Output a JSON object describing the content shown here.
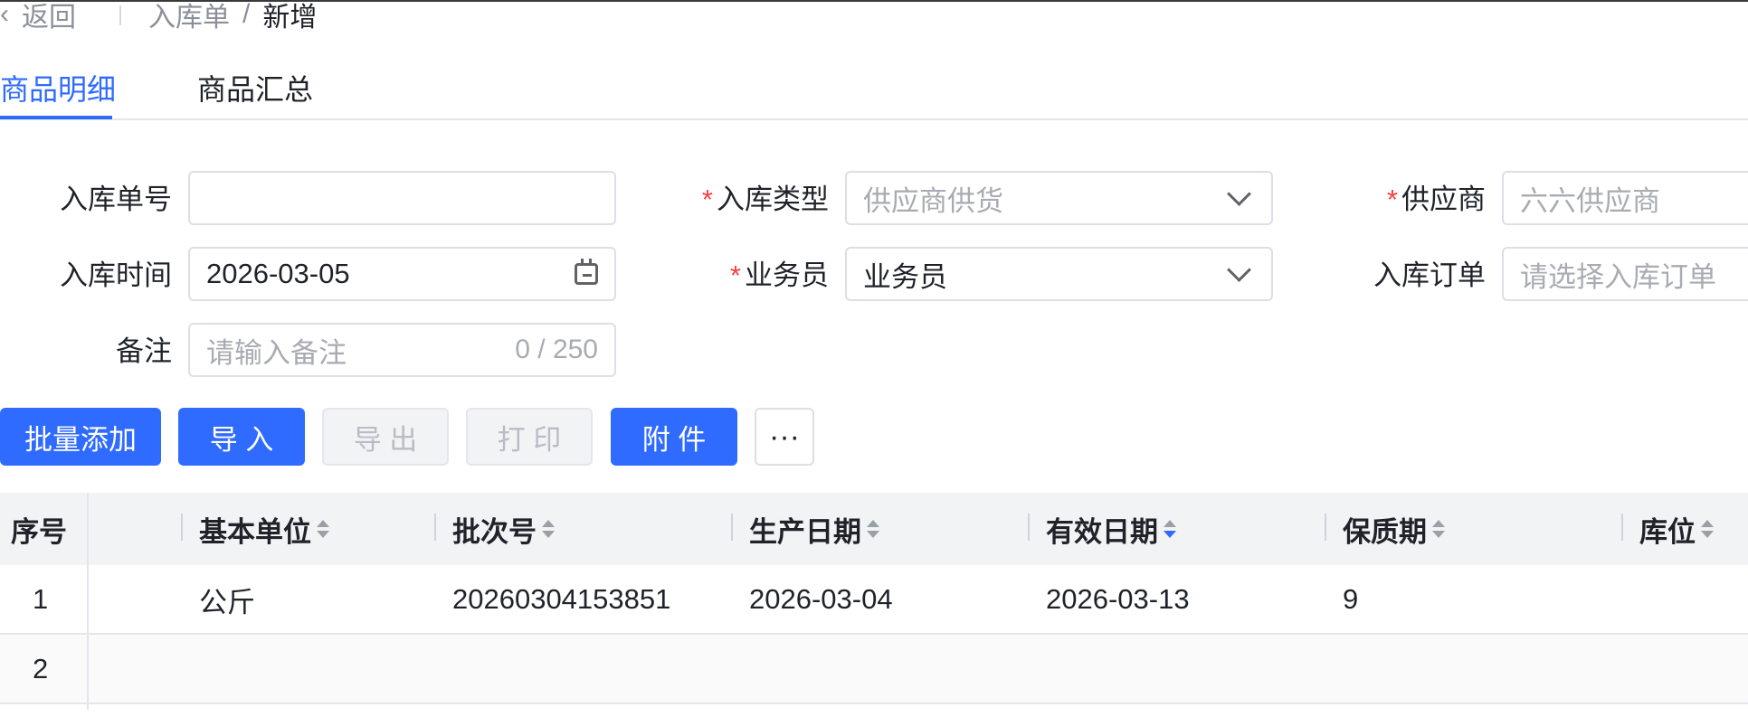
{
  "breadcrumb": {
    "back_label": "返回",
    "parent": "入库单",
    "separator": "/",
    "current": "新增"
  },
  "tabs": [
    {
      "label": "商品明细",
      "active": true
    },
    {
      "label": "商品汇总",
      "active": false
    }
  ],
  "form": {
    "inbound_no": {
      "label": "入库单号",
      "value": ""
    },
    "inbound_type": {
      "label": "入库类型",
      "required_mark": "*",
      "placeholder": "供应商供货"
    },
    "supplier": {
      "label": "供应商",
      "required_mark": "*",
      "placeholder": "六六供应商"
    },
    "inbound_time": {
      "label": "入库时间",
      "value": "2026-03-05"
    },
    "salesperson": {
      "label": "业务员",
      "required_mark": "*",
      "value": "业务员"
    },
    "inbound_order": {
      "label": "入库订单",
      "placeholder": "请选择入库订单"
    },
    "remark": {
      "label": "备注",
      "placeholder": "请输入备注",
      "counter": "0 / 250"
    }
  },
  "toolbar": {
    "batch_add": "批量添加",
    "import": "导 入",
    "export": "导 出",
    "print": "打 印",
    "attach": "附 件",
    "more": "···"
  },
  "table": {
    "columns": [
      "序号",
      "基本单位",
      "批次号",
      "生产日期",
      "有效日期",
      "保质期",
      "库位"
    ],
    "rows": [
      {
        "index": "1",
        "unit": "公斤",
        "batch": "20260304153851",
        "produced": "2026-03-04",
        "expiry": "2026-03-13",
        "shelf_life": "9",
        "location": ""
      },
      {
        "index": "2",
        "unit": "",
        "batch": "",
        "produced": "",
        "expiry": "",
        "shelf_life": "",
        "location": ""
      }
    ]
  },
  "colors": {
    "primary": "#2f6bff",
    "required": "#f53f3f",
    "placeholder": "#a8abb2"
  }
}
